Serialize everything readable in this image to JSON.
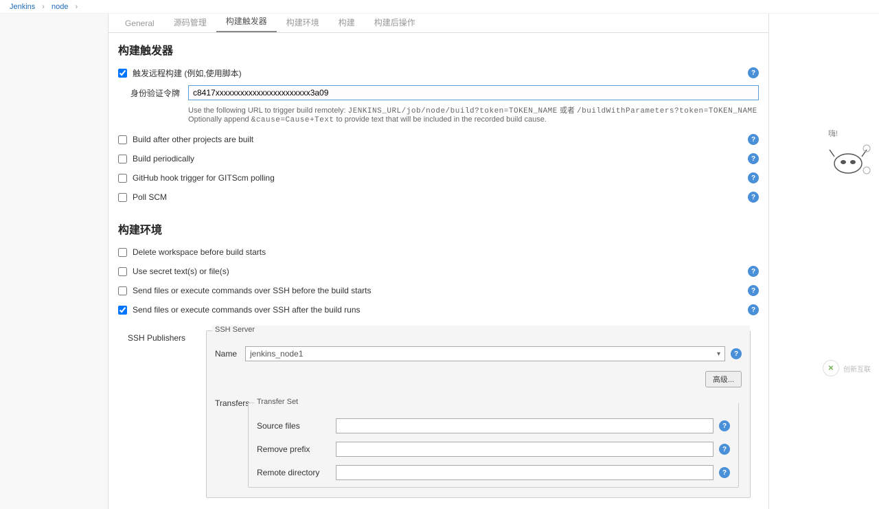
{
  "breadcrumb": {
    "root": "Jenkins",
    "item": "node"
  },
  "tabs": [
    {
      "label": "General",
      "active": false
    },
    {
      "label": "源码管理",
      "active": false
    },
    {
      "label": "构建触发器",
      "active": true
    },
    {
      "label": "构建环境",
      "active": false
    },
    {
      "label": "构建",
      "active": false
    },
    {
      "label": "构建后操作",
      "active": false
    }
  ],
  "triggers": {
    "title": "构建触发器",
    "remote": {
      "label": "触发远程构建 (例如,使用脚本)",
      "checked": true,
      "token_label": "身份验证令牌",
      "token_value": "c8417xxxxxxxxxxxxxxxxxxxxxxx3a09",
      "hint1": "Use the following URL to trigger build remotely: ",
      "hint1_mono": "JENKINS_URL/job/node/build?token=TOKEN_NAME",
      "hint1_or": " 或者 ",
      "hint1_mono2": "/buildWithParameters?token=TOKEN_NAME",
      "hint2": "Optionally append ",
      "hint2_mono": "&cause=Cause+Text",
      "hint2_tail": " to provide text that will be included in the recorded build cause."
    },
    "opts": [
      {
        "label": "Build after other projects are built",
        "checked": false,
        "help": true
      },
      {
        "label": "Build periodically",
        "checked": false,
        "help": true
      },
      {
        "label": "GitHub hook trigger for GITScm polling",
        "checked": false,
        "help": true
      },
      {
        "label": "Poll SCM",
        "checked": false,
        "help": true
      }
    ]
  },
  "env": {
    "title": "构建环境",
    "opts": [
      {
        "label": "Delete workspace before build starts",
        "checked": false,
        "help": false
      },
      {
        "label": "Use secret text(s) or file(s)",
        "checked": false,
        "help": true
      },
      {
        "label": "Send files or execute commands over SSH before the build starts",
        "checked": false,
        "help": true
      },
      {
        "label": "Send files or execute commands over SSH after the build runs",
        "checked": true,
        "help": true
      }
    ],
    "ssh": {
      "publishers_label": "SSH Publishers",
      "server_legend": "SSH Server",
      "name_label": "Name",
      "name_value": "jenkins_node1",
      "advanced": "高级...",
      "transfers_label": "Transfers",
      "transfer_legend": "Transfer Set",
      "source_files": "Source files",
      "remove_prefix": "Remove prefix",
      "remote_directory": "Remote directory"
    }
  },
  "mascot_text": "嗨!",
  "footer_brand": "创新互联"
}
